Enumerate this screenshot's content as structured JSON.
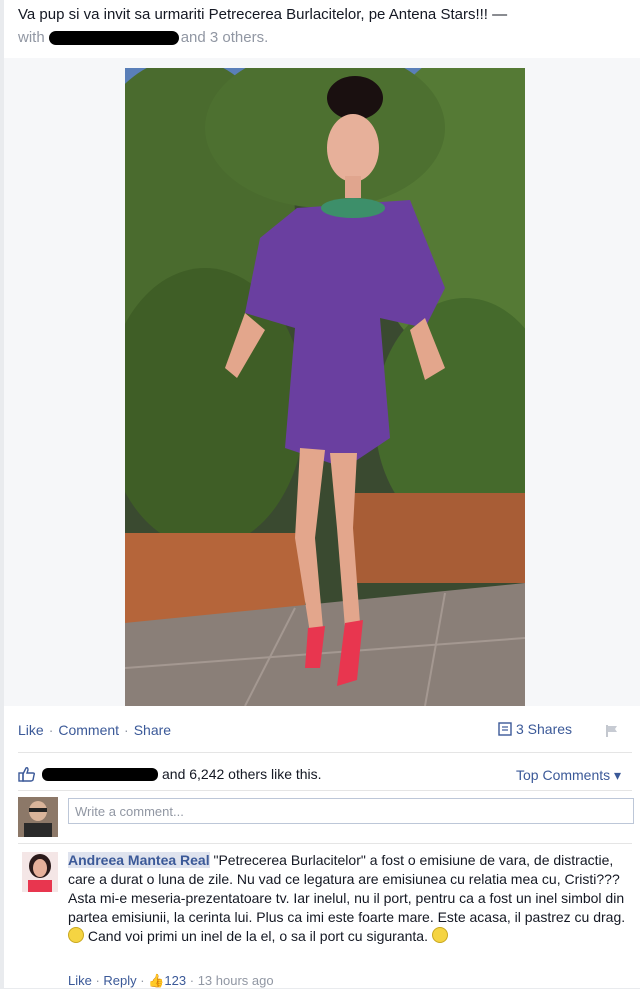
{
  "post": {
    "message": "Va pup si va invit sa urmariti Petrecerea Burlacitelor, pe Antena Stars!!! —",
    "with_prefix": "with",
    "with_suffix": "and 3 others."
  },
  "actions": {
    "like": "Like",
    "comment": "Comment",
    "share": "Share",
    "shares_count": "3 Shares"
  },
  "likes": {
    "text": "and 6,242 others like this.",
    "top_comments": "Top Comments ▾"
  },
  "composer": {
    "placeholder": "Write a comment..."
  },
  "comment": {
    "author": "Andreea Mantea Real",
    "text": " \"Petrecerea Burlacitelor\" a fost o emisiune de vara, de distractie, care a durat o luna de zile. Nu vad ce legatura are emisiunea cu relatia mea cu, Cristi??? Asta mi-e meseria-prezentatoare tv. Iar inelul, nu il port, pentru ca a fost un inel simbol din partea emisiunii, la cerinta lui. Plus ca imi este foarte mare. Este acasa, il pastrez cu drag.",
    "text2": " Cand voi primi un inel de la el, o sa il port cu siguranta.",
    "like": "Like",
    "reply": "Reply",
    "like_count": "123",
    "time": "13 hours ago"
  },
  "colors": {
    "link": "#3b5998",
    "muted": "#9197a3",
    "dress": "#6a3fa0"
  }
}
